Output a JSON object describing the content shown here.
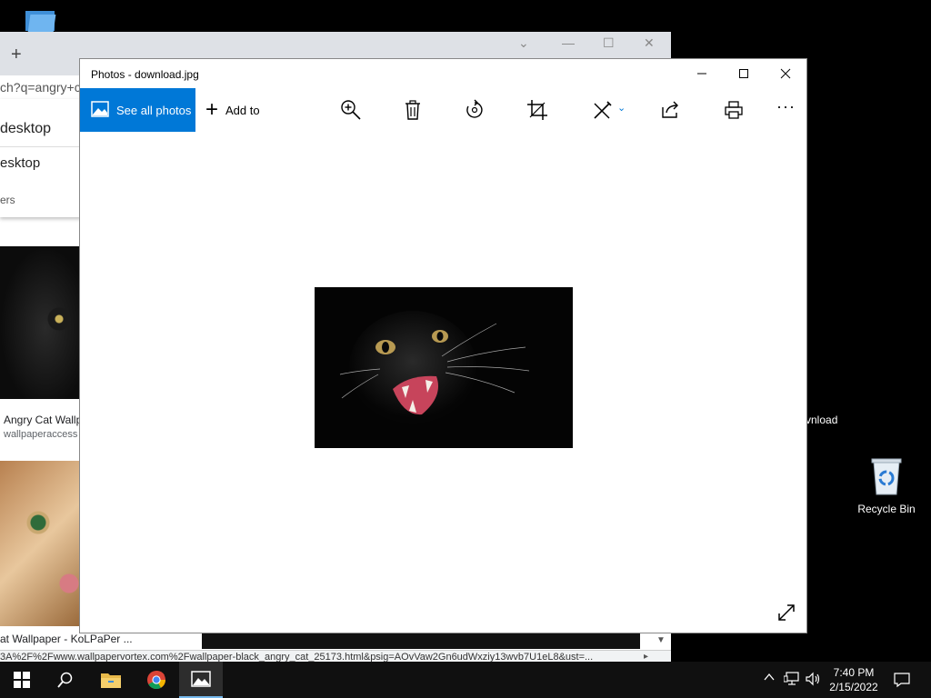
{
  "desktop": {
    "recycle_bin_label": "Recycle Bin",
    "download_label": "vnload"
  },
  "chrome": {
    "address_text": "ch?q=angry+c",
    "suggestion_1": "desktop",
    "suggestion_2": "esktop",
    "filters_text": "ers",
    "result_1_title": "Angry Cat Wallp",
    "result_1_source": "wallpaperaccess",
    "result_2_title": "at Wallpaper - KoLPaPer ...",
    "status_url": "3A%2F%2Fwww.wallpapervortex.com%2Fwallpaper-black_angry_cat_25173.html&psig=AOvVaw2Gn6udWxziy13wvb7U1eL8&ust=..."
  },
  "photos": {
    "window_title": "Photos - download.jpg",
    "see_all_label": "See all photos",
    "add_to_label": "Add to",
    "toolbar_icons": [
      "zoom-icon",
      "delete-icon",
      "rotate-icon",
      "crop-icon",
      "edit-icon",
      "share-icon",
      "print-icon",
      "more-icon"
    ],
    "accent_color": "#0078d7"
  },
  "taskbar": {
    "time": "7:40 PM",
    "date": "2/15/2022"
  }
}
